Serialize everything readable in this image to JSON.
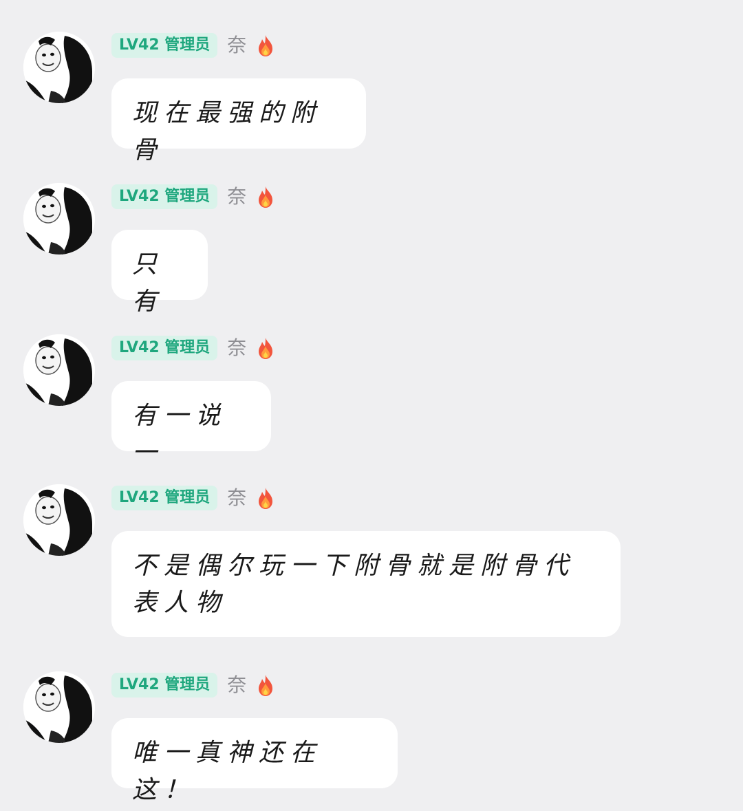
{
  "messages": [
    {
      "badge": "LV42 管理员",
      "nickname": "奈",
      "avatar_icon": "panda-meme-avatar-icon",
      "level_icon": "fire-icon",
      "text": "现在最强的附骨"
    },
    {
      "badge": "LV42 管理员",
      "nickname": "奈",
      "avatar_icon": "panda-meme-avatar-icon",
      "level_icon": "fire-icon",
      "text": "只有"
    },
    {
      "badge": "LV42 管理员",
      "nickname": "奈",
      "avatar_icon": "panda-meme-avatar-icon",
      "level_icon": "fire-icon",
      "text": "有一说一"
    },
    {
      "badge": "LV42 管理员",
      "nickname": "奈",
      "avatar_icon": "panda-meme-avatar-icon",
      "level_icon": "fire-icon",
      "text": "不是偶尔玩一下附骨就是附骨代表人物"
    },
    {
      "badge": "LV42 管理员",
      "nickname": "奈",
      "avatar_icon": "panda-meme-avatar-icon",
      "level_icon": "fire-icon",
      "text": "唯一真神还在这！"
    }
  ],
  "colors": {
    "background": "#efeff1",
    "bubble": "#ffffff",
    "badge_bg": "#d9f3ea",
    "badge_text": "#1fa77e",
    "nickname": "#8e8e93"
  }
}
